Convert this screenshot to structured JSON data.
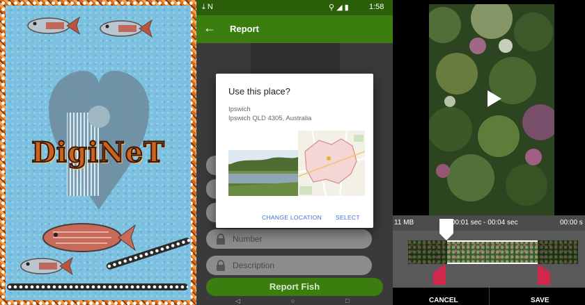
{
  "splash": {
    "logo_text": "DigiNeT"
  },
  "phone": {
    "status_bar": {
      "left_icons": "⤓ N",
      "time": "1:58"
    },
    "app_bar": {
      "back_icon": "arrow-left-icon",
      "title": "Report"
    },
    "dialog": {
      "title": "Use this place?",
      "place_name": "Ipswich",
      "place_address": "Ipswich QLD 4305, Australia",
      "change_location_label": "CHANGE LOCATION",
      "select_label": "SELECT"
    },
    "form": {
      "number_placeholder": "Number",
      "description_placeholder": "Description",
      "report_button": "Report Fish"
    },
    "nav": {
      "back": "◁",
      "home": "○",
      "recents": "□"
    }
  },
  "video_editor": {
    "file_size": "11 MB",
    "range": "00:01 sec - 00:04 sec",
    "end_time": "00:00 s",
    "cancel_label": "CANCEL",
    "save_label": "SAVE",
    "colors": {
      "handle": "#d0284d",
      "timeline_bg": "#595959"
    }
  },
  "colors": {
    "app_green": "#3c7d0f",
    "status_green": "#2b5e08",
    "dialog_link": "#3b6fd6"
  }
}
